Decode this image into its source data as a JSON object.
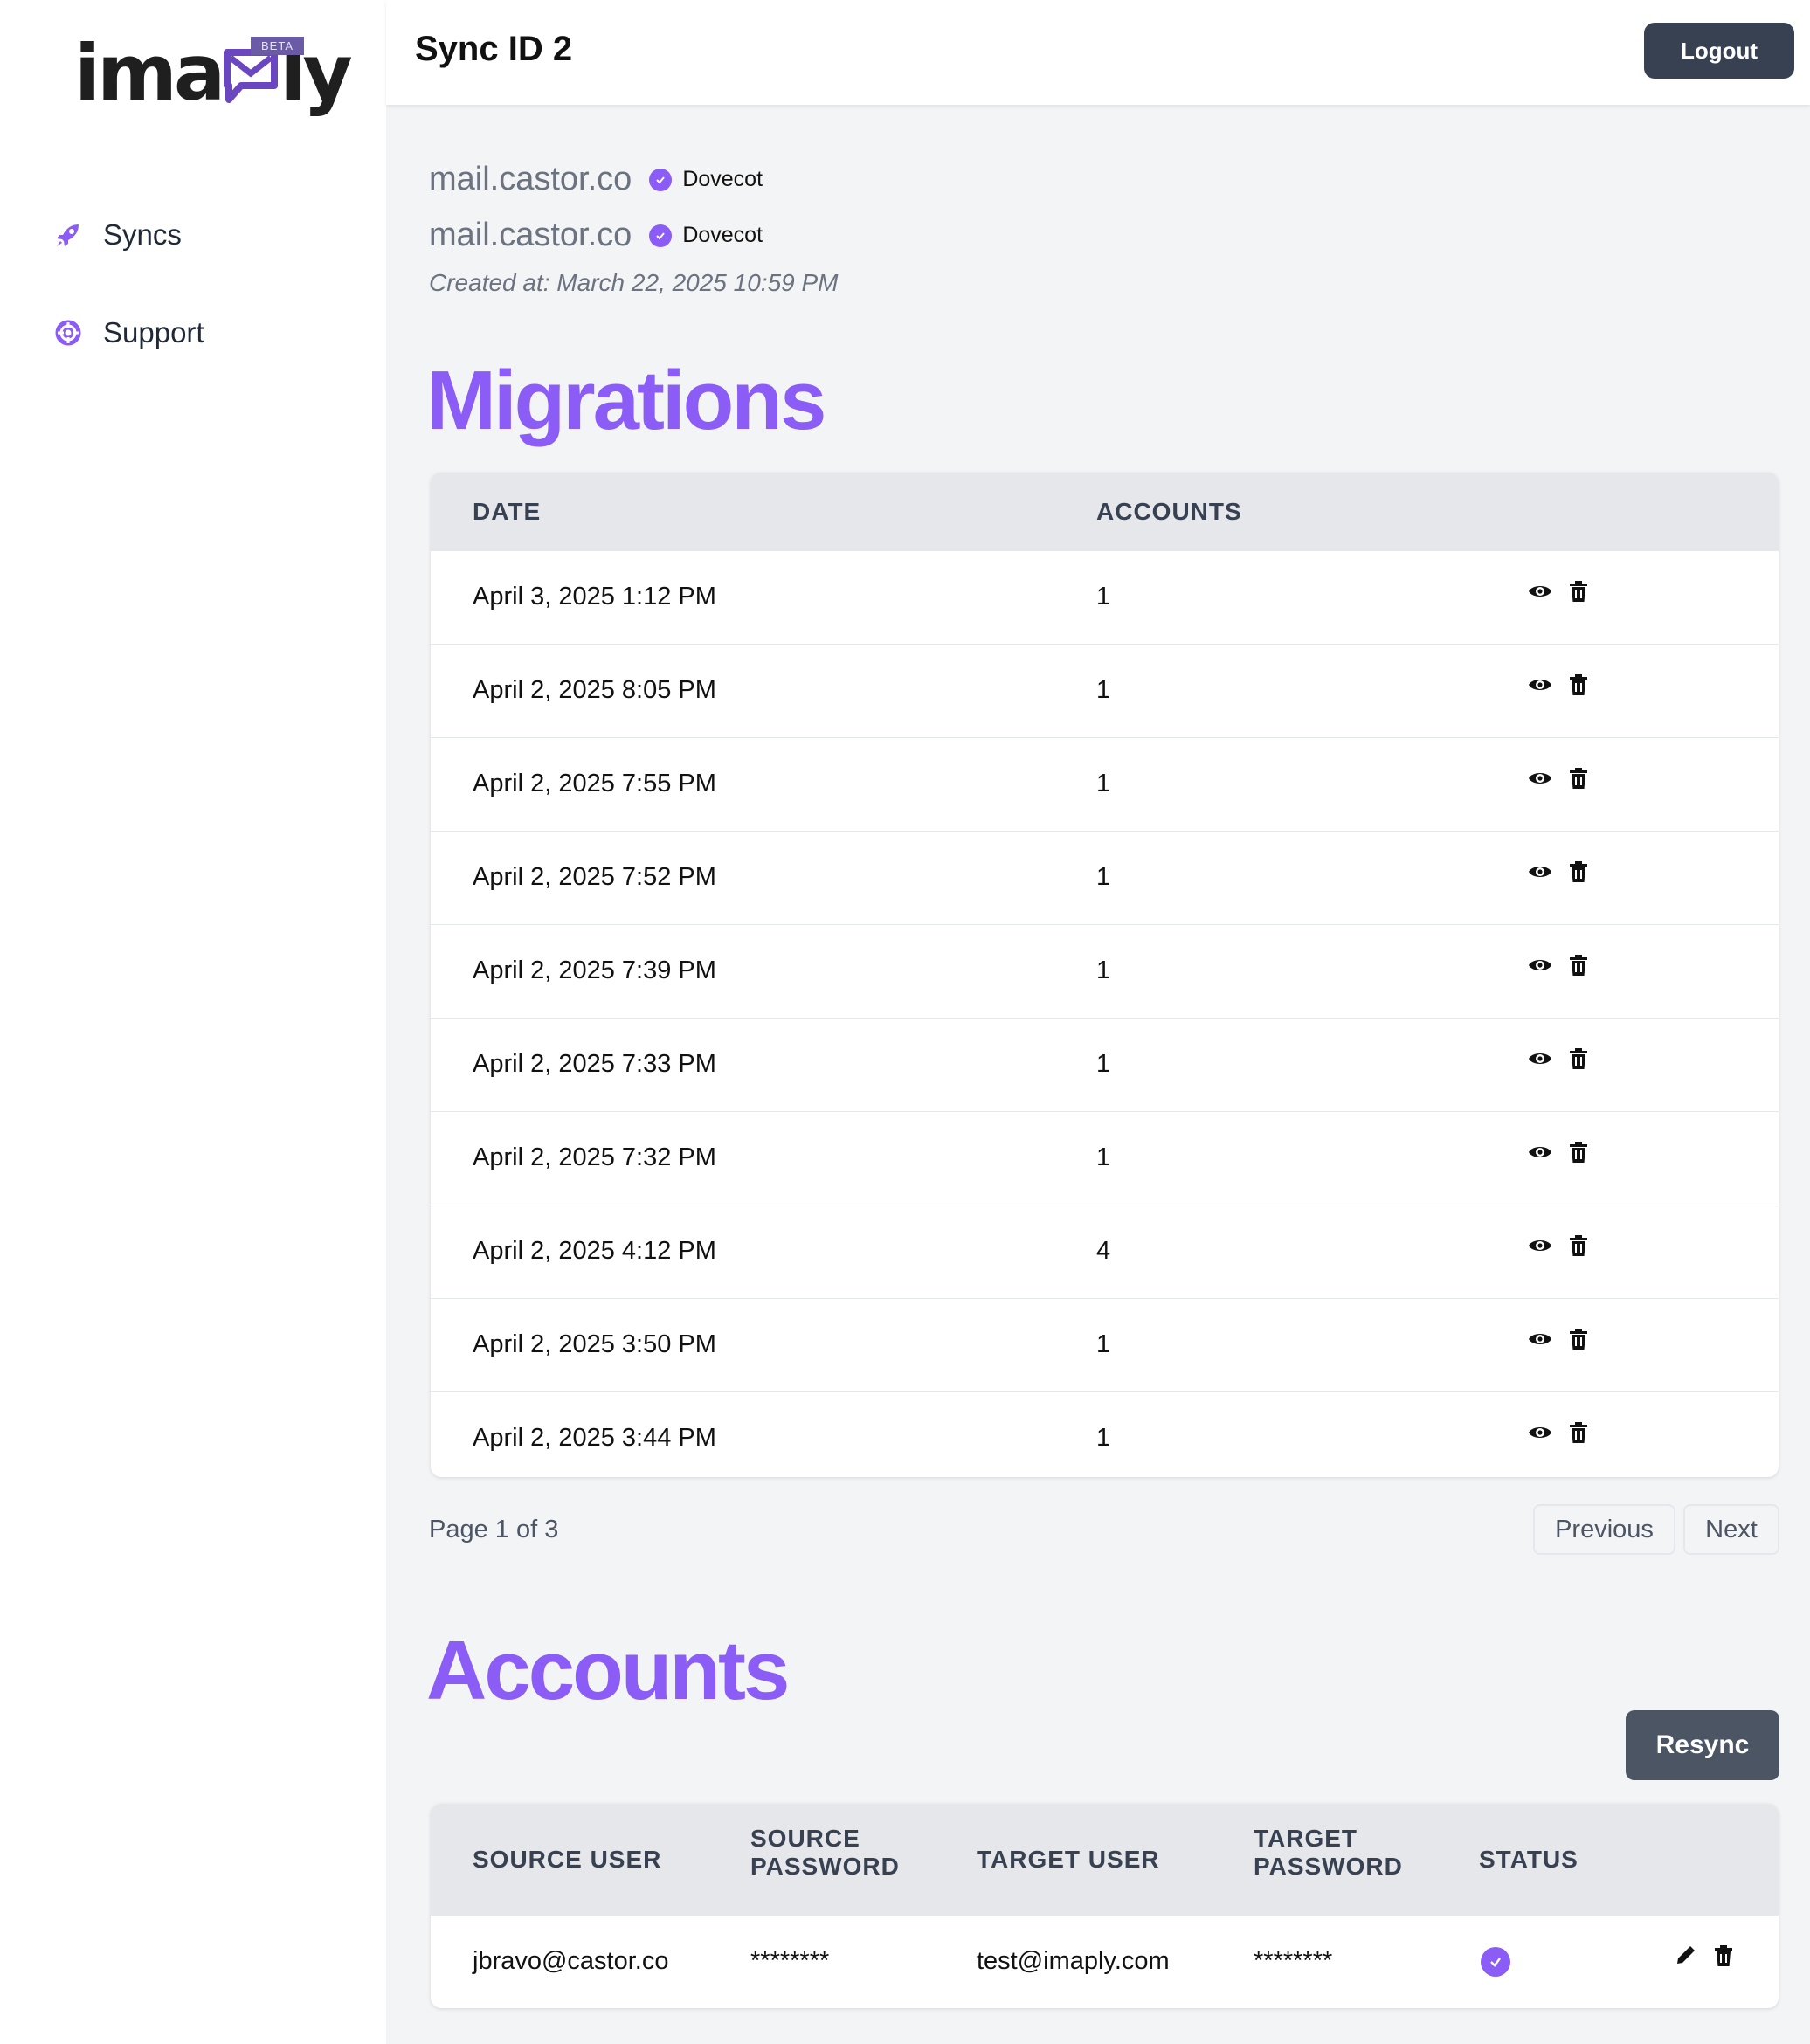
{
  "brand": {
    "logo_prefix": "ima",
    "logo_suffix": "ly",
    "badge": "BETA"
  },
  "sidebar": {
    "items": [
      {
        "label": "Syncs",
        "icon": "rocket-icon"
      },
      {
        "label": "Support",
        "icon": "lifebuoy-icon"
      }
    ]
  },
  "header": {
    "title": "Sync ID 2",
    "logout_label": "Logout"
  },
  "sync": {
    "source_host": "mail.castor.co",
    "source_type": "Dovecot",
    "target_host": "mail.castor.co",
    "target_type": "Dovecot",
    "created": "Created at: March 22, 2025 10:59 PM"
  },
  "migrations": {
    "title": "Migrations",
    "columns": [
      "DATE",
      "ACCOUNTS"
    ],
    "rows": [
      {
        "date": "April 3, 2025 1:12 PM",
        "accounts": "1"
      },
      {
        "date": "April 2, 2025 8:05 PM",
        "accounts": "1"
      },
      {
        "date": "April 2, 2025 7:55 PM",
        "accounts": "1"
      },
      {
        "date": "April 2, 2025 7:52 PM",
        "accounts": "1"
      },
      {
        "date": "April 2, 2025 7:39 PM",
        "accounts": "1"
      },
      {
        "date": "April 2, 2025 7:33 PM",
        "accounts": "1"
      },
      {
        "date": "April 2, 2025 7:32 PM",
        "accounts": "1"
      },
      {
        "date": "April 2, 2025 4:12 PM",
        "accounts": "4"
      },
      {
        "date": "April 2, 2025 3:50 PM",
        "accounts": "1"
      },
      {
        "date": "April 2, 2025 3:44 PM",
        "accounts": "1"
      }
    ],
    "pagination": {
      "text": "Page 1 of 3",
      "previous": "Previous",
      "next": "Next"
    }
  },
  "accounts": {
    "title": "Accounts",
    "resync_label": "Resync",
    "columns": {
      "source_user": "SOURCE USER",
      "source_password_1": "SOURCE",
      "source_password_2": "PASSWORD",
      "target_user": "TARGET USER",
      "target_password_1": "TARGET",
      "target_password_2": "PASSWORD",
      "status": "STATUS"
    },
    "rows": [
      {
        "source_user": "jbravo@castor.co",
        "source_password": "********",
        "target_user": "test@imaply.com",
        "target_password": "********",
        "status": "completed"
      }
    ]
  },
  "colors": {
    "accent": "#8b5cf6",
    "dark_button": "#374151",
    "sidebar_bg": "#ffffff",
    "page_bg": "#f3f4f6"
  }
}
